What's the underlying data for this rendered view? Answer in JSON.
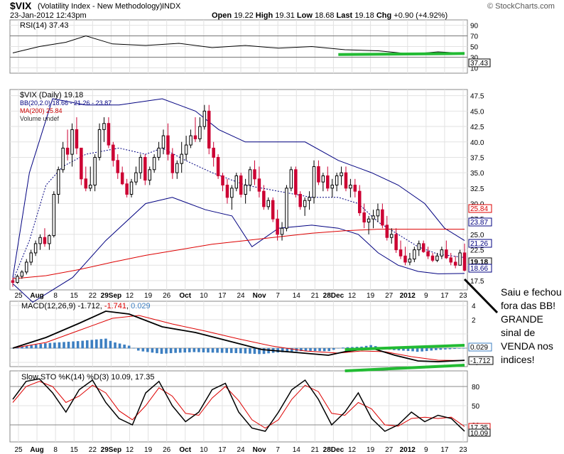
{
  "header": {
    "symbol": "$VIX",
    "name": "(Volatility Index - New Methodology)",
    "exchange": "INDX",
    "brand": "© StockCharts.com",
    "date": "23-Jan-2012 12:43pm",
    "open_label": "Open",
    "open": "19.22",
    "high_label": "High",
    "high": "19.31",
    "low_label": "Low",
    "low": "18.68",
    "last_label": "Last",
    "last": "19.18",
    "chg_label": "Chg",
    "chg": "+0.90 (+4.92%)"
  },
  "rsi_panel": {
    "legend": "RSI(14) 37.43",
    "ticks": [
      "90",
      "70",
      "50",
      "30",
      "10"
    ],
    "last_label": "37.43",
    "line_color": "#000000"
  },
  "price_panel": {
    "legend_main": "$VIX (Daily) 19.18",
    "legend_bb": "BB(20,2.0) 18.66 - 21.26 - 23.87",
    "legend_ma": "MA(200) 25.84",
    "legend_vol": "Volume undef",
    "ticks": [
      "47.5",
      "45.0",
      "42.5",
      "40.0",
      "37.5",
      "35.0",
      "32.5",
      "30.0",
      "27.5",
      "25.0",
      "22.5",
      "20.0",
      "17.5"
    ],
    "right_labels": [
      "25.84",
      "23.87",
      "21.26",
      "19.18",
      "18.66"
    ],
    "bb_color": "#000080",
    "ma_color": "#dd0000",
    "up_color": "#000000",
    "down_color": "#cc0033"
  },
  "xaxis_labels": [
    "25",
    "Aug",
    "8",
    "15",
    "22",
    "29Sep",
    "12",
    "19",
    "26",
    "Oct",
    "10",
    "17",
    "24",
    "Nov",
    "7",
    "14",
    "21",
    "28Dec",
    "12",
    "19",
    "27",
    "2012",
    "9",
    "17",
    "23"
  ],
  "macd_panel": {
    "legend_label": "MACD(12,26,9)",
    "macd_value": "-1.712",
    "signal_value": "-1.741",
    "hist_value": "0.029",
    "ticks": [
      "4",
      "2",
      "0",
      "-2",
      "-4"
    ],
    "right_labels": [
      "0.029",
      "-1.712"
    ],
    "hist_color": "#3d7fc1"
  },
  "sto_panel": {
    "legend": "Slow STO %K(14) %D(3) 10.09, 17.35",
    "ticks": [
      "80",
      "50",
      "20"
    ],
    "right_labels": [
      "17.35",
      "10.09"
    ]
  },
  "annotation": {
    "text": "Saiu e fechou fora das BB! GRANDE sinal de VENDA nos indices!",
    "highlight_color": "#22bb33"
  },
  "chart_data": {
    "type": "candlestick",
    "title": "$VIX (Volatility Index - New Methodology) INDX",
    "x_start": "2011-07-25",
    "x_end": "2012-01-23",
    "ylim": [
      16.0,
      48.5
    ],
    "bb_upper": [
      [
        0,
        18
      ],
      [
        5,
        35
      ],
      [
        12,
        47
      ],
      [
        22,
        46
      ],
      [
        32,
        46
      ],
      [
        45,
        47
      ],
      [
        55,
        45
      ],
      [
        62,
        42
      ],
      [
        70,
        40
      ],
      [
        78,
        40
      ],
      [
        88,
        40
      ],
      [
        98,
        37
      ],
      [
        108,
        35
      ],
      [
        116,
        33
      ],
      [
        124,
        30
      ],
      [
        130,
        26
      ],
      [
        136,
        24
      ]
    ],
    "bb_mid": [
      [
        0,
        17.5
      ],
      [
        5,
        24
      ],
      [
        10,
        33
      ],
      [
        15,
        36
      ],
      [
        22,
        38
      ],
      [
        32,
        39
      ],
      [
        40,
        38
      ],
      [
        45,
        39
      ],
      [
        52,
        37
      ],
      [
        60,
        35
      ],
      [
        70,
        33
      ],
      [
        80,
        32
      ],
      [
        90,
        31
      ],
      [
        98,
        31
      ],
      [
        104,
        30
      ],
      [
        110,
        27
      ],
      [
        116,
        25
      ],
      [
        122,
        23
      ],
      [
        128,
        21.8
      ],
      [
        136,
        21.26
      ]
    ],
    "bb_lower": [
      [
        0,
        17
      ],
      [
        6,
        14
      ],
      [
        18,
        18
      ],
      [
        28,
        24
      ],
      [
        40,
        30
      ],
      [
        48,
        31
      ],
      [
        58,
        29
      ],
      [
        66,
        28
      ],
      [
        72,
        23
      ],
      [
        80,
        26
      ],
      [
        90,
        26.5
      ],
      [
        98,
        26
      ],
      [
        104,
        25
      ],
      [
        110,
        22
      ],
      [
        116,
        20
      ],
      [
        122,
        19
      ],
      [
        128,
        18.6
      ],
      [
        136,
        18.66
      ]
    ],
    "ma200": [
      [
        0,
        17.8
      ],
      [
        10,
        18.3
      ],
      [
        20,
        19.3
      ],
      [
        30,
        20.5
      ],
      [
        40,
        21.6
      ],
      [
        50,
        22.5
      ],
      [
        60,
        23.4
      ],
      [
        70,
        24.0
      ],
      [
        80,
        24.6
      ],
      [
        90,
        25.2
      ],
      [
        100,
        25.6
      ],
      [
        110,
        25.84
      ],
      [
        136,
        25.84
      ]
    ],
    "ohlc": [
      [
        17.5,
        18,
        16.5,
        17.2
      ],
      [
        17.2,
        18.5,
        17,
        18.2
      ],
      [
        18.2,
        19.2,
        17.8,
        18.9
      ],
      [
        18.9,
        21,
        18.5,
        20.5
      ],
      [
        20.5,
        22.5,
        20,
        22
      ],
      [
        22,
        24,
        21.5,
        23.5
      ],
      [
        23.5,
        25,
        22.5,
        24.5
      ],
      [
        24.5,
        26,
        23,
        23.5
      ],
      [
        23.5,
        25,
        22.5,
        24.8
      ],
      [
        24.8,
        32,
        24.5,
        31.5
      ],
      [
        31.5,
        36,
        30,
        35.5
      ],
      [
        35.5,
        40,
        35,
        39
      ],
      [
        39,
        42,
        37,
        38
      ],
      [
        38,
        43,
        36,
        42
      ],
      [
        42,
        44,
        38,
        39
      ],
      [
        39,
        38,
        33,
        34
      ],
      [
        34,
        36,
        32,
        32.5
      ],
      [
        32.5,
        36,
        32,
        33
      ],
      [
        33,
        38,
        32,
        37.5
      ],
      [
        37.5,
        43,
        37,
        42
      ],
      [
        42,
        44,
        40,
        43
      ],
      [
        43,
        44,
        39,
        39.5
      ],
      [
        39.5,
        40,
        36,
        37
      ],
      [
        37,
        38,
        34,
        35
      ],
      [
        35,
        36,
        33,
        33.2
      ],
      [
        33.2,
        34,
        31,
        31.5
      ],
      [
        31.5,
        34,
        31,
        33.5
      ],
      [
        33.5,
        36,
        33,
        35
      ],
      [
        35,
        38,
        34,
        37.5
      ],
      [
        37.5,
        38,
        33,
        33.8
      ],
      [
        33.8,
        36,
        33,
        35.5
      ],
      [
        35.5,
        38,
        35,
        37.5
      ],
      [
        37.5,
        40,
        37,
        39
      ],
      [
        39,
        42,
        38,
        41
      ],
      [
        41,
        43,
        37,
        38
      ],
      [
        38,
        39,
        34,
        35
      ],
      [
        35,
        37,
        34,
        36.5
      ],
      [
        36.5,
        40,
        35,
        38
      ],
      [
        38,
        41,
        37,
        39.5
      ],
      [
        39.5,
        42,
        39,
        41
      ],
      [
        41,
        44,
        40,
        40.5
      ],
      [
        40.5,
        44,
        40,
        42.5
      ],
      [
        42.5,
        46,
        42,
        45
      ],
      [
        45,
        46,
        38,
        39
      ],
      [
        39,
        40,
        36,
        37.5
      ],
      [
        37.5,
        38,
        34,
        34.5
      ],
      [
        34.5,
        35,
        32,
        33
      ],
      [
        33,
        34,
        30,
        31
      ],
      [
        31,
        33,
        29,
        32.5
      ],
      [
        32.5,
        35,
        32,
        34.5
      ],
      [
        34.5,
        35,
        31,
        31.5
      ],
      [
        31.5,
        34,
        30,
        33
      ],
      [
        33,
        36,
        32,
        35.5
      ],
      [
        35.5,
        37,
        33,
        34
      ],
      [
        34,
        36,
        31,
        32
      ],
      [
        32,
        33,
        29,
        29.5
      ],
      [
        29.5,
        31,
        29,
        30.5
      ],
      [
        30.5,
        31,
        27,
        27.5
      ],
      [
        27.5,
        29,
        24,
        25
      ],
      [
        25,
        27,
        24,
        26
      ],
      [
        26,
        33,
        25.5,
        32.5
      ],
      [
        32.5,
        36,
        32,
        35.5
      ],
      [
        35.5,
        36,
        31,
        31.5
      ],
      [
        31.5,
        32,
        29,
        29.5
      ],
      [
        29.5,
        31,
        28,
        30.5
      ],
      [
        30.5,
        32,
        29,
        31
      ],
      [
        31,
        37,
        30,
        36
      ],
      [
        36,
        37,
        33,
        33.5
      ],
      [
        33.5,
        35,
        32,
        34.5
      ],
      [
        34.5,
        36,
        32,
        32.5
      ],
      [
        32.5,
        34,
        31,
        33
      ],
      [
        33,
        35,
        32,
        34.5
      ],
      [
        34.5,
        36,
        33,
        35
      ],
      [
        35,
        36,
        32,
        32.5
      ],
      [
        32.5,
        34,
        31,
        33
      ],
      [
        33,
        34,
        31,
        32
      ],
      [
        32,
        33,
        28,
        28.5
      ],
      [
        28.5,
        30,
        26,
        27
      ],
      [
        27,
        28,
        25,
        27.5
      ],
      [
        27.5,
        29,
        26,
        28
      ],
      [
        28,
        30,
        27,
        29
      ],
      [
        29,
        30,
        26,
        26.5
      ],
      [
        26.5,
        28,
        24,
        24.5
      ],
      [
        24.5,
        26,
        23.5,
        25
      ],
      [
        25,
        26,
        22,
        22.5
      ],
      [
        22.5,
        24,
        21,
        21.5
      ],
      [
        21.5,
        23,
        20,
        20.5
      ],
      [
        20.5,
        22,
        20,
        21
      ],
      [
        21,
        23,
        20.5,
        22.5
      ],
      [
        22.5,
        24,
        21.5,
        23.5
      ],
      [
        23.5,
        24,
        22,
        22.2
      ],
      [
        22.2,
        23,
        21,
        21.5
      ],
      [
        21.5,
        22,
        20.5,
        20.8
      ],
      [
        20.8,
        22,
        20.5,
        21.5
      ],
      [
        21.5,
        23,
        21,
        22.5
      ],
      [
        22.5,
        24,
        21,
        21.2
      ],
      [
        21.2,
        22,
        20,
        20.5
      ],
      [
        20.5,
        21.5,
        19.5,
        20
      ],
      [
        20,
        22.5,
        20,
        22
      ],
      [
        22,
        23.5,
        19,
        19.18
      ]
    ],
    "rsi": [
      [
        0,
        38
      ],
      [
        8,
        50
      ],
      [
        16,
        58
      ],
      [
        22,
        70
      ],
      [
        30,
        55
      ],
      [
        40,
        52
      ],
      [
        50,
        56
      ],
      [
        60,
        48
      ],
      [
        70,
        52
      ],
      [
        80,
        47
      ],
      [
        90,
        50
      ],
      [
        100,
        44
      ],
      [
        110,
        42
      ],
      [
        120,
        36
      ],
      [
        128,
        40
      ],
      [
        136,
        37.43
      ]
    ],
    "macd": [
      [
        0,
        0
      ],
      [
        10,
        1.5
      ],
      [
        20,
        3.5
      ],
      [
        28,
        5.2
      ],
      [
        35,
        4.8
      ],
      [
        45,
        3.0
      ],
      [
        55,
        2.2
      ],
      [
        65,
        1.0
      ],
      [
        75,
        -0.2
      ],
      [
        85,
        -0.6
      ],
      [
        95,
        -1.0
      ],
      [
        100,
        -0.5
      ],
      [
        108,
        0
      ],
      [
        115,
        -1.0
      ],
      [
        122,
        -1.8
      ],
      [
        128,
        -1.9
      ],
      [
        136,
        -1.712
      ]
    ],
    "signal": [
      [
        0,
        0
      ],
      [
        10,
        0.8
      ],
      [
        20,
        2.5
      ],
      [
        30,
        4.2
      ],
      [
        38,
        4.6
      ],
      [
        48,
        3.4
      ],
      [
        58,
        2.4
      ],
      [
        68,
        1.3
      ],
      [
        78,
        0.3
      ],
      [
        88,
        -0.4
      ],
      [
        98,
        -0.7
      ],
      [
        105,
        -0.4
      ],
      [
        112,
        -0.5
      ],
      [
        120,
        -1.2
      ],
      [
        128,
        -1.7
      ],
      [
        136,
        -1.741
      ]
    ],
    "sto_k": [
      [
        0,
        60
      ],
      [
        4,
        88
      ],
      [
        8,
        92
      ],
      [
        12,
        70
      ],
      [
        16,
        40
      ],
      [
        20,
        75
      ],
      [
        24,
        90
      ],
      [
        28,
        55
      ],
      [
        32,
        30
      ],
      [
        36,
        20
      ],
      [
        40,
        70
      ],
      [
        44,
        88
      ],
      [
        48,
        50
      ],
      [
        52,
        25
      ],
      [
        56,
        40
      ],
      [
        60,
        75
      ],
      [
        64,
        85
      ],
      [
        68,
        40
      ],
      [
        72,
        15
      ],
      [
        76,
        10
      ],
      [
        80,
        40
      ],
      [
        84,
        75
      ],
      [
        88,
        90
      ],
      [
        92,
        60
      ],
      [
        96,
        20
      ],
      [
        100,
        40
      ],
      [
        104,
        70
      ],
      [
        108,
        30
      ],
      [
        112,
        10
      ],
      [
        116,
        20
      ],
      [
        120,
        40
      ],
      [
        124,
        25
      ],
      [
        128,
        35
      ],
      [
        132,
        30
      ],
      [
        136,
        10.09
      ]
    ],
    "sto_d": [
      [
        0,
        55
      ],
      [
        4,
        80
      ],
      [
        8,
        88
      ],
      [
        12,
        80
      ],
      [
        16,
        55
      ],
      [
        20,
        65
      ],
      [
        24,
        82
      ],
      [
        28,
        70
      ],
      [
        32,
        42
      ],
      [
        36,
        28
      ],
      [
        40,
        50
      ],
      [
        44,
        78
      ],
      [
        48,
        65
      ],
      [
        52,
        38
      ],
      [
        56,
        35
      ],
      [
        60,
        62
      ],
      [
        64,
        80
      ],
      [
        68,
        58
      ],
      [
        72,
        28
      ],
      [
        76,
        15
      ],
      [
        80,
        28
      ],
      [
        84,
        60
      ],
      [
        88,
        82
      ],
      [
        92,
        72
      ],
      [
        96,
        38
      ],
      [
        100,
        35
      ],
      [
        104,
        55
      ],
      [
        108,
        45
      ],
      [
        112,
        20
      ],
      [
        116,
        18
      ],
      [
        120,
        30
      ],
      [
        124,
        32
      ],
      [
        128,
        30
      ],
      [
        132,
        32
      ],
      [
        136,
        17.35
      ]
    ]
  }
}
